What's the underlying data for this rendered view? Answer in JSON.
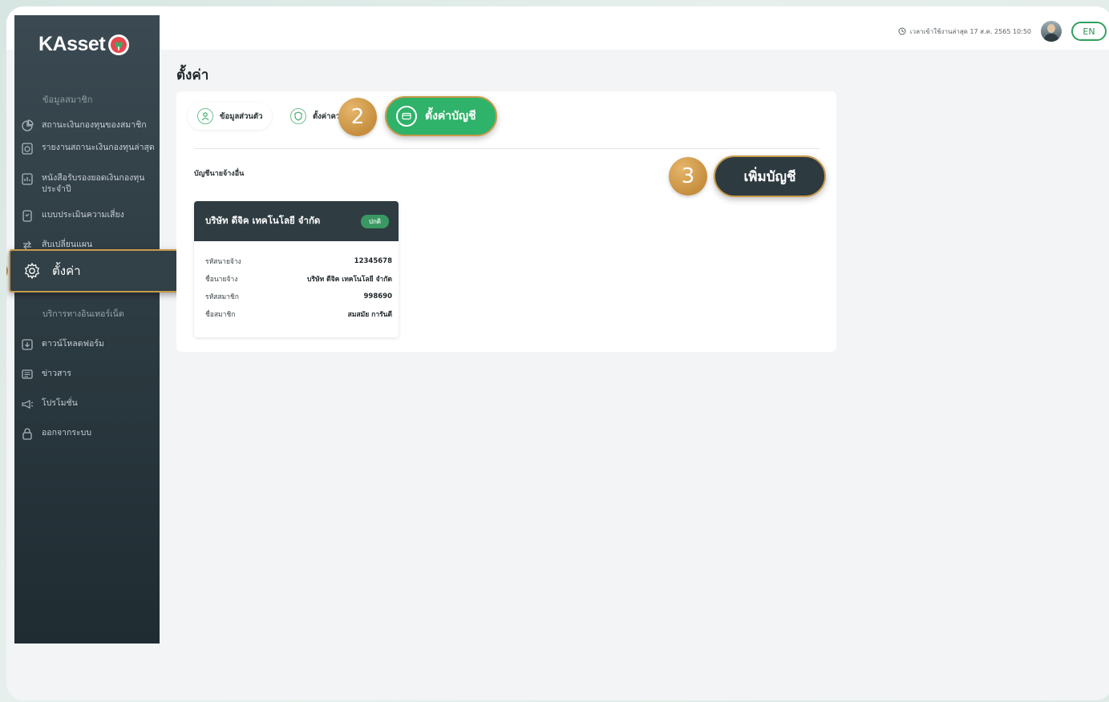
{
  "app": {
    "logo_text": "KAsset"
  },
  "header": {
    "last_login": "เวลาเข้าใช้งานล่าสุด 17 ส.ค. 2565 10:50",
    "lang": "EN"
  },
  "sidebar": {
    "section_label": "ข้อมูลสมาชิก",
    "items": [
      {
        "label": "สถานะเงินกองทุนของสมาชิก",
        "icon": "pie-chart-icon"
      },
      {
        "label": "รายงานสถานะเงินกองทุนล่าสุด",
        "icon": "report-icon"
      },
      {
        "label": "หนังสือรับรองยอดเงินกองทุนประจำปี",
        "icon": "certificate-icon"
      },
      {
        "label": "แบบประเมินความเสี่ยง",
        "icon": "assessment-icon"
      },
      {
        "label": "สับเปลี่ยนแผน",
        "icon": "switch-icon"
      },
      {
        "label": "ตั้งค่า",
        "icon": "gear-icon",
        "active": true
      },
      {
        "label": "บริการทางอินเทอร์เน็ต",
        "icon": "",
        "sub": true
      },
      {
        "label": "ดาวน์โหลดฟอร์ม",
        "icon": "download-icon"
      },
      {
        "label": "ข่าวสาร",
        "icon": "news-icon"
      },
      {
        "label": "โปรโมชั่น",
        "icon": "megaphone-icon"
      },
      {
        "label": "ออกจากระบบ",
        "icon": "lock-icon"
      }
    ]
  },
  "main": {
    "title": "ตั้งค่า",
    "tabs": [
      {
        "label": "ข้อมูลส่วนตัว",
        "icon": "user-icon"
      },
      {
        "label": "ตั้งค่าคว",
        "icon": "shield-icon"
      },
      {
        "label": "ตั้งค่าบัญชี",
        "icon": "card-icon",
        "active": true
      }
    ],
    "steps": {
      "two": "2",
      "three": "3"
    },
    "section_title": "บัญชีนายจ้างอื่น",
    "add_button": "เพิ่มบัญชี",
    "employer_card": {
      "company": "บริษัท ดีจิค เทคโนโลยี จำกัด",
      "status": "ปกติ",
      "rows": [
        {
          "label": "รหัสนายจ้าง",
          "value": "12345678"
        },
        {
          "label": "ชื่อนายจ้าง",
          "value": "บริษัท ดีจิค เทคโนโลยี จำกัด"
        },
        {
          "label": "รหัสสมาชิก",
          "value": "998690"
        },
        {
          "label": "ชื่อสมาชิก",
          "value": "สมสมัย การันตี"
        }
      ]
    }
  },
  "colors": {
    "accent_green": "#2fb26a",
    "highlight_gold": "#c79a4b",
    "sidebar_dark": "#2c3a41"
  }
}
